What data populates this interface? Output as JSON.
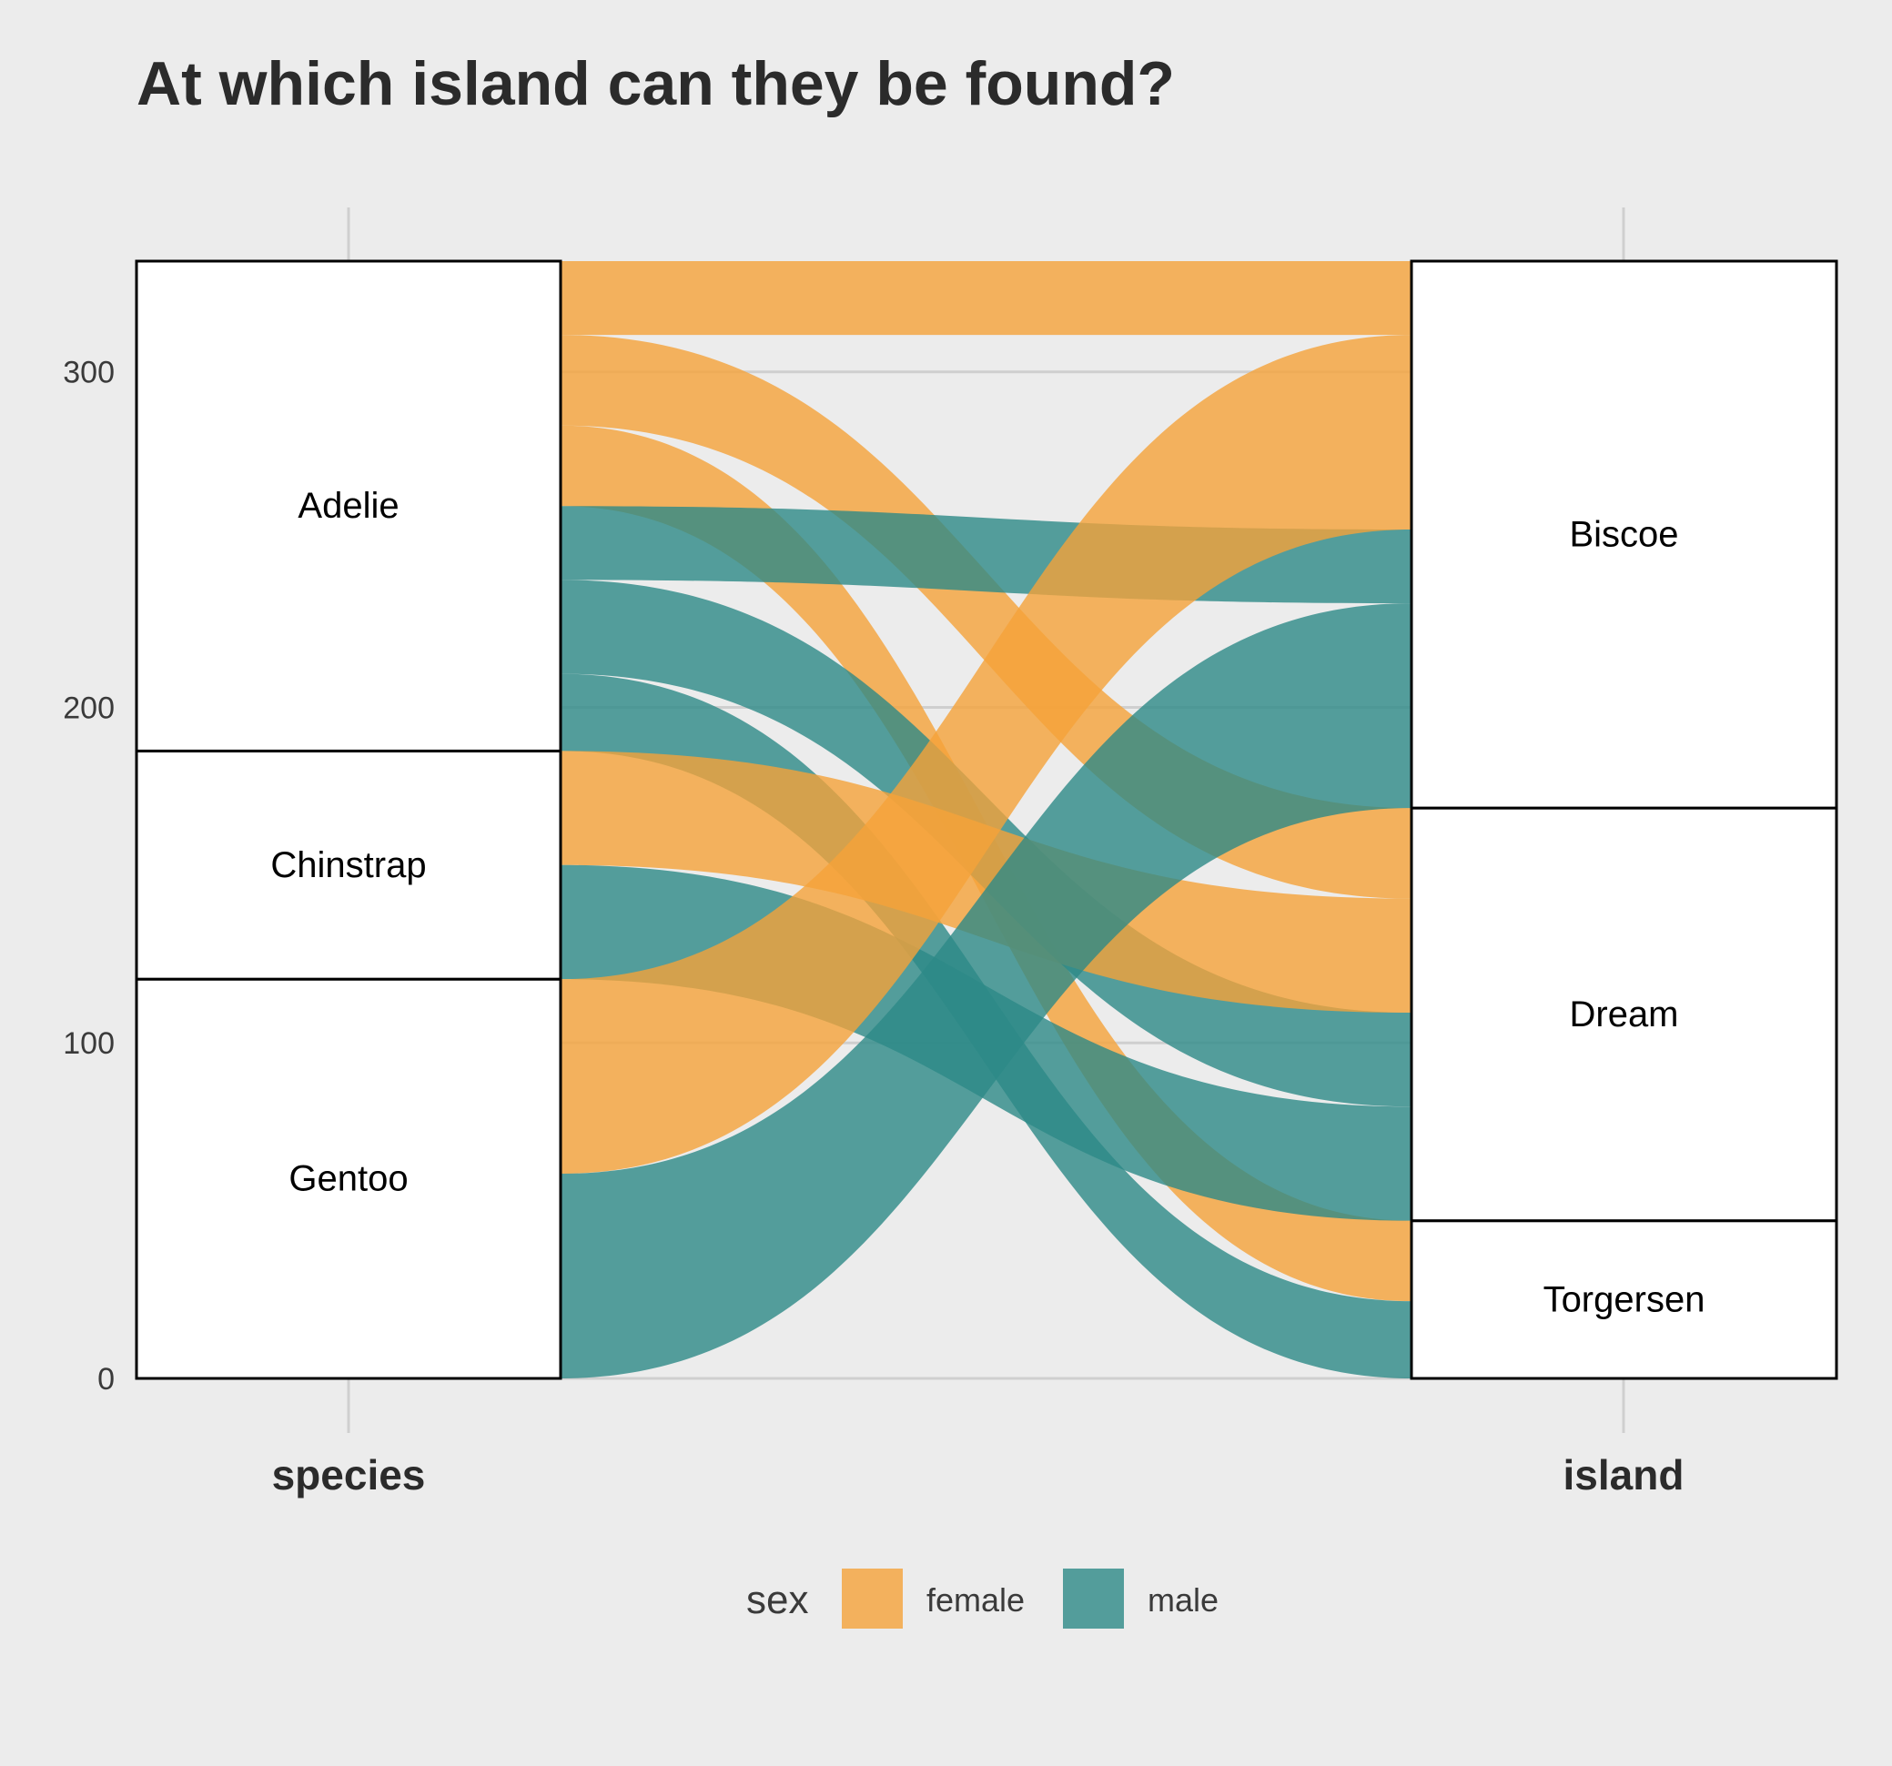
{
  "chart_data": {
    "type": "alluvial",
    "title": "At which island can they be found?",
    "axes": [
      "species",
      "island"
    ],
    "ylim": [
      0,
      333
    ],
    "y_ticks": [
      0,
      100,
      200,
      300
    ],
    "grid": "major y gridlines on",
    "legend_position": "bottom",
    "legend_title": "sex",
    "colors": {
      "female": "#f5a33a",
      "male": "#2d8a87"
    },
    "species_strata": [
      {
        "label": "Gentoo",
        "count": 119
      },
      {
        "label": "Chinstrap",
        "count": 68
      },
      {
        "label": "Adelie",
        "count": 146
      }
    ],
    "island_strata": [
      {
        "label": "Torgersen",
        "count": 47
      },
      {
        "label": "Dream",
        "count": 123
      },
      {
        "label": "Biscoe",
        "count": 163
      }
    ],
    "flows": [
      {
        "species": "Adelie",
        "island": "Torgersen",
        "sex": "female",
        "count": 24
      },
      {
        "species": "Adelie",
        "island": "Torgersen",
        "sex": "male",
        "count": 23
      },
      {
        "species": "Adelie",
        "island": "Dream",
        "sex": "female",
        "count": 27
      },
      {
        "species": "Adelie",
        "island": "Dream",
        "sex": "male",
        "count": 28
      },
      {
        "species": "Adelie",
        "island": "Biscoe",
        "sex": "female",
        "count": 22
      },
      {
        "species": "Adelie",
        "island": "Biscoe",
        "sex": "male",
        "count": 22
      },
      {
        "species": "Chinstrap",
        "island": "Dream",
        "sex": "female",
        "count": 34
      },
      {
        "species": "Chinstrap",
        "island": "Dream",
        "sex": "male",
        "count": 34
      },
      {
        "species": "Gentoo",
        "island": "Biscoe",
        "sex": "female",
        "count": 58
      },
      {
        "species": "Gentoo",
        "island": "Biscoe",
        "sex": "male",
        "count": 61
      }
    ],
    "legend": [
      {
        "key": "female",
        "label": "female"
      },
      {
        "key": "male",
        "label": "male"
      }
    ]
  }
}
